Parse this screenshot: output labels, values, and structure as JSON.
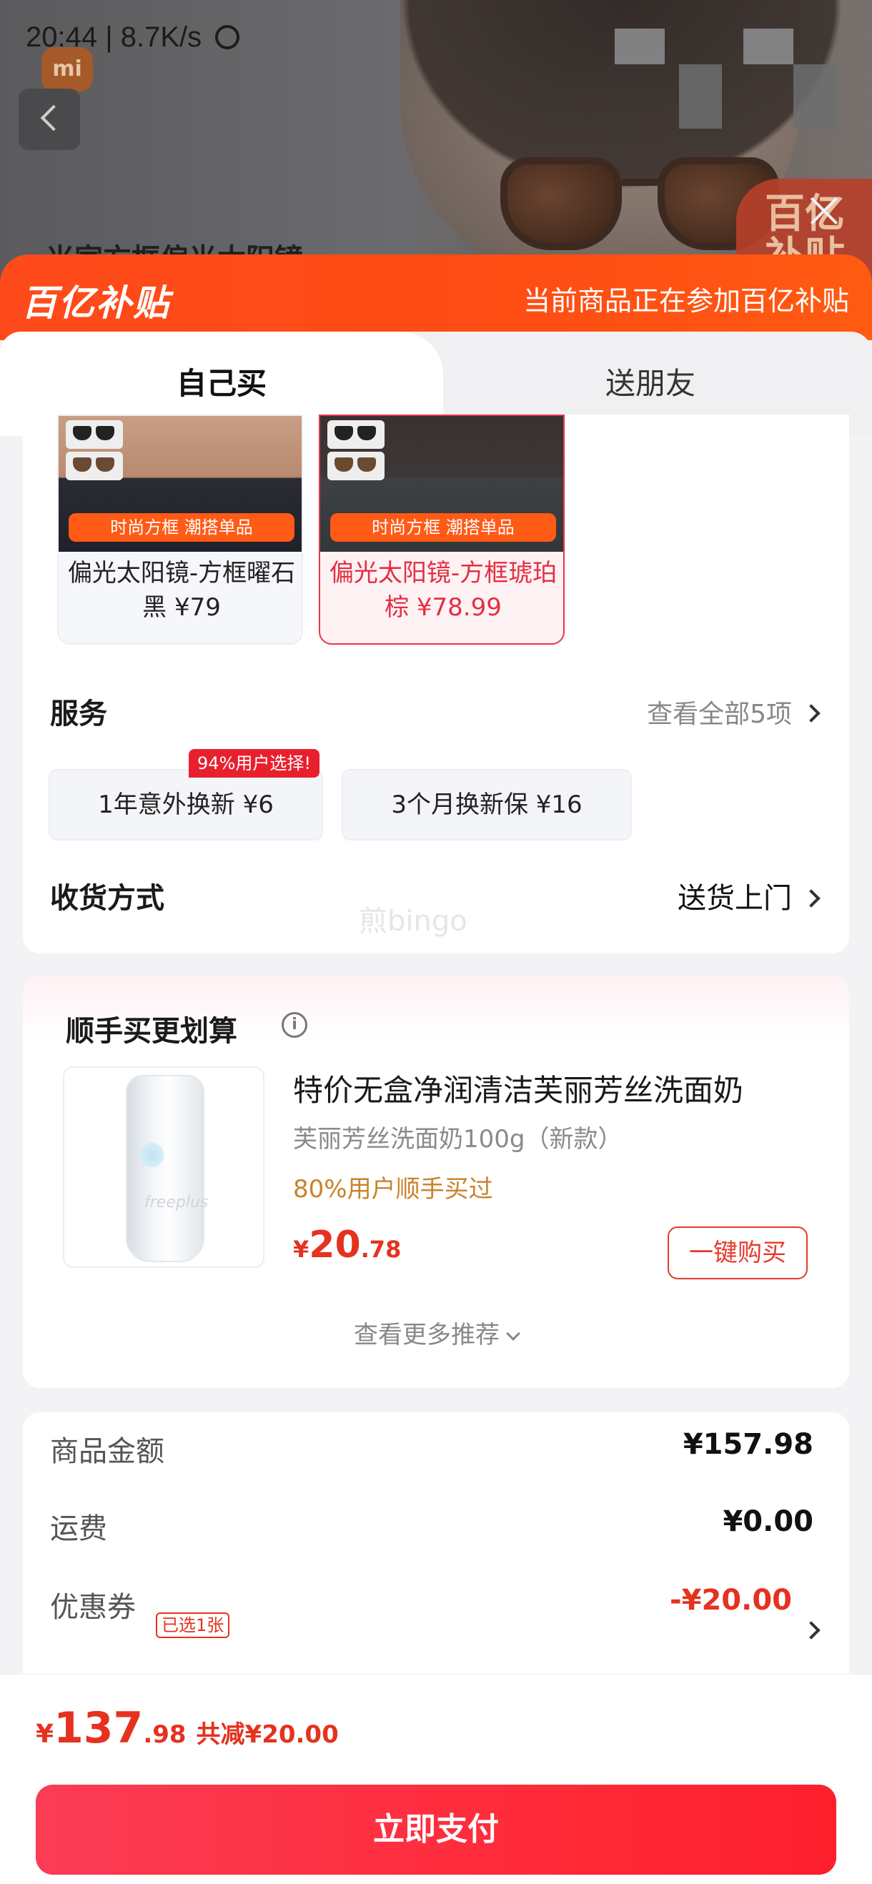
{
  "status_bar": {
    "time": "20:44",
    "speed": "8.7K/s"
  },
  "background_page": {
    "title": "米家方框偏光太阳镜",
    "badge": "百亿补贴"
  },
  "sheet": {
    "brand": "百亿补贴",
    "notice": "当前商品正在参加百亿补贴",
    "accent_color": "#ff4a1c"
  },
  "tabs": [
    {
      "label": "自己买",
      "active": true
    },
    {
      "label": "送朋友",
      "active": false
    }
  ],
  "variants": [
    {
      "tag": "时尚方框 潮搭单品",
      "name": "偏光太阳镜-方框曜石黑 ¥79",
      "selected": false
    },
    {
      "tag": "时尚方框 潮搭单品",
      "name": "偏光太阳镜-方框琥珀棕 ¥78.99",
      "selected": true
    }
  ],
  "services": {
    "label": "服务",
    "view_all": "查看全部5项",
    "badge": "94%用户选择!",
    "options": [
      {
        "label": "1年意外换新 ¥6"
      },
      {
        "label": "3个月换新保 ¥16"
      }
    ]
  },
  "delivery": {
    "label": "收货方式",
    "value": "送货上门"
  },
  "watermark": "煎bingo",
  "addon": {
    "title": "顺手买更划算",
    "product": {
      "title": "特价无盒净润清洁芙丽芳丝洗面奶",
      "subtitle": "芙丽芳丝洗面奶100g（新款）",
      "tip": "80%用户顺手买过",
      "price_symbol": "¥",
      "price_int": "20",
      "price_dec": ".78",
      "buy_label": "一键购买",
      "image_logo": "freeplus"
    },
    "more_label": "查看更多推荐"
  },
  "summary": {
    "rows": [
      {
        "label": "商品金额",
        "value": "¥157.98"
      },
      {
        "label": "运费",
        "value": "¥0.00"
      },
      {
        "label": "优惠券",
        "tag": "已选1张",
        "value": "-¥20.00"
      }
    ]
  },
  "footer": {
    "price_symbol": "¥",
    "price_int": "137",
    "price_dec": ".98",
    "saving": "共减¥20.00",
    "pay_label": "立即支付"
  }
}
